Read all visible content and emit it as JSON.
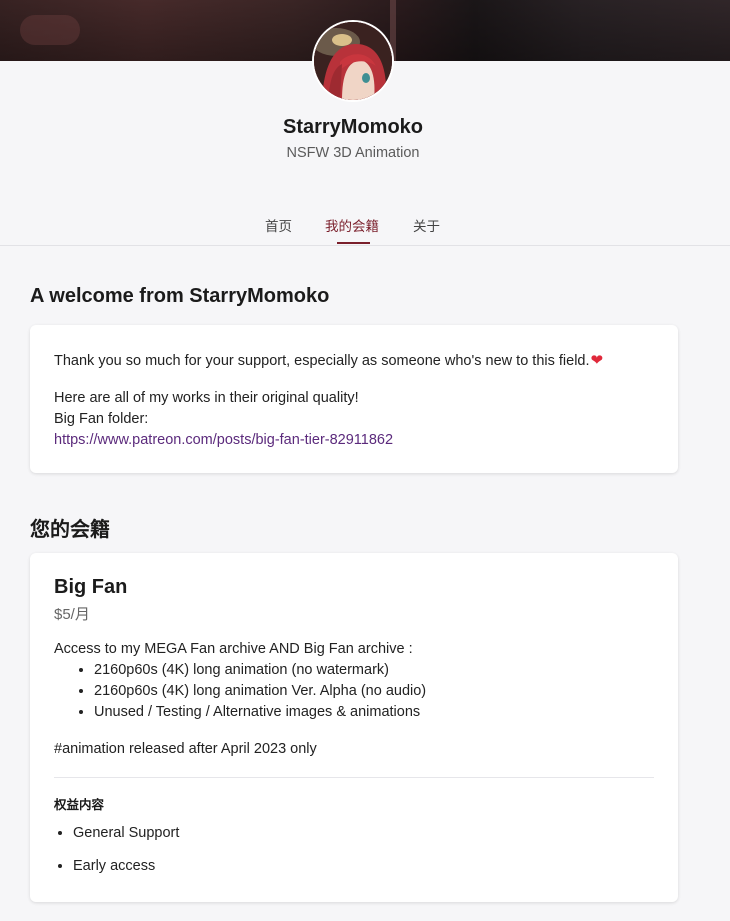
{
  "creator": {
    "name": "StarryMomoko",
    "tagline": "NSFW 3D Animation"
  },
  "nav": {
    "tabs": [
      {
        "label": "首页",
        "active": false
      },
      {
        "label": "我的会籍",
        "active": true
      },
      {
        "label": "关于",
        "active": false
      }
    ]
  },
  "welcome": {
    "title": "A welcome from StarryMomoko",
    "line1": "Thank you so much for your support, especially as someone who's new to this field.",
    "heart": "❤",
    "line2": "Here are all of my works in their original quality!",
    "line3": "Big Fan folder:",
    "link": "https://www.patreon.com/posts/big-fan-tier-82911862"
  },
  "membership": {
    "title": "您的会籍",
    "tier_name": "Big Fan",
    "price": "$5/月",
    "intro": "Access to my MEGA Fan archive AND Big Fan archive :",
    "items": [
      "2160p60s (4K) long animation (no watermark)",
      "2160p60s (4K) long animation Ver. Alpha (no audio)",
      "Unused / Testing / Alternative images & animations"
    ],
    "note": "#animation released after April 2023 only",
    "benefits_title": "权益内容",
    "benefits": [
      "General Support",
      "Early access"
    ]
  },
  "colors": {
    "accent": "#7a1f2b",
    "link": "#5b2a7c",
    "page_bg": "#f6f6f8"
  }
}
